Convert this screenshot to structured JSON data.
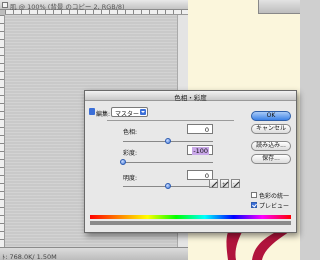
{
  "document_window": {
    "title": "肌 @ 100% (背景 のコピー 2, RGB/8)",
    "status": "ﾄ: 768.0K/ 1.50M"
  },
  "dialog": {
    "title": "色相・彩度",
    "edit": {
      "label": "編集:",
      "selected": "マスター"
    },
    "hue": {
      "label": "色相:",
      "value": "0",
      "level": 0
    },
    "saturation": {
      "label": "彩度:",
      "value": "-100",
      "level": -100
    },
    "lightness": {
      "label": "明度:",
      "value": "0",
      "level": 0
    },
    "buttons": {
      "ok": "OK",
      "cancel": "キャンセル",
      "load": "読み込み...",
      "save": "保存..."
    },
    "colorize": {
      "label": "色彩の統一",
      "checked": false
    },
    "preview": {
      "label": "プレビュー",
      "checked": true
    }
  },
  "colors": {
    "accent": "#3b6fd8",
    "art_background": "#fbf6dc",
    "art_stroke": "#b0143c"
  },
  "icons": [
    "eyedropper-icon",
    "eyedropper-plus-icon",
    "eyedropper-minus-icon"
  ]
}
